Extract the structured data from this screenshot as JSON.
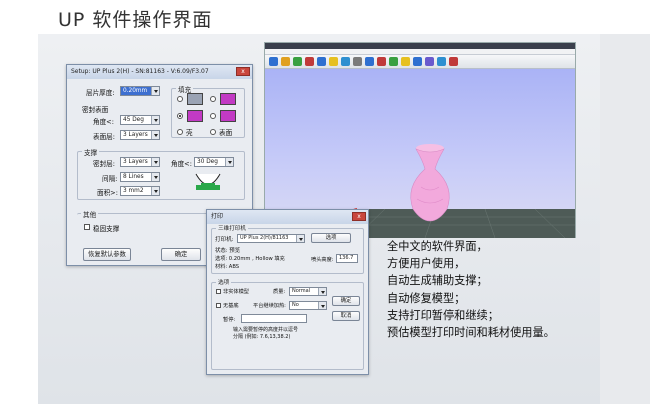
{
  "page": {
    "title": "UP 软件操作界面"
  },
  "setup_dialog": {
    "title": "Setup: UP Plus 2(H) - SN:81163 - V:6.09/F3.07",
    "close_label": "x",
    "layer_thickness_label": "层片厚度:",
    "layer_thickness_value": "0.20mm",
    "fill_label": "填充",
    "dense_surface_label": "密封表面",
    "angle_label": "角度<:",
    "angle_value": "45 Deg",
    "surface_layers_label": "表面层:",
    "surface_layers_value": "3 Layers",
    "shell_label": "壳",
    "surface_label": "表面",
    "support_label": "支撑",
    "support_dense_label": "密封层:",
    "support_dense_value": "3 Layers",
    "support_angle_label": "角度<:",
    "support_angle_value": "30 Deg",
    "spacing_label": "间隔:",
    "spacing_value": "8 Lines",
    "area_label": "面积>:",
    "area_value": "3 mm2",
    "other_label": "其他",
    "stable_support_label": "稳固支撑",
    "restore_defaults_button": "恢复默认参数",
    "ok_button": "确定"
  },
  "app_window": {
    "toolbar_icon_colors": [
      "#2e6fd0",
      "#e0a020",
      "#3aa040",
      "#c03a3a",
      "#2e6fd0",
      "#e6c020",
      "#2e8fd0",
      "#7a7a7a",
      "#2e6fd0",
      "#c03a3a",
      "#3aa040",
      "#e6c020",
      "#2e6fd0",
      "#6a5acd",
      "#2e8fd0",
      "#c03a3a"
    ],
    "accent_colors": {
      "platform": "#51605a",
      "model": "#f0a8d8",
      "sky_top": "#aab3f6"
    }
  },
  "print_dialog": {
    "title": "打印",
    "close_label": "x",
    "printer_group": "三维打印机",
    "printer_label": "打印机:",
    "printer_value": "UP Plus 2(H)/81163",
    "select_button": "选项",
    "status_label": "状态: 预览",
    "settings_label": "选项: 0.20mm , Hollow 填充",
    "material_label": "材料: ABS",
    "nozzle_height_label": "喷头高度:",
    "nozzle_height_value": "136.7",
    "options_group": "选项",
    "unsolid_label": "非实体模型",
    "quality_label": "质量:",
    "quality_value": "Normal",
    "no_raft_label": "无基底",
    "platform_heat_label": "平台继续加热:",
    "platform_heat_value": "No",
    "ok_button": "确定",
    "cancel_button": "取消",
    "pause_label": "暂停:",
    "pause_hint_1": "输入需要暂停的高度并以逗号",
    "pause_hint_2": "分隔 (例如: 7.6,13,38.2)"
  },
  "features": [
    "全中文的软件界面，",
    "方便用户使用，",
    "自动生成辅助支撑；",
    "自动修复模型；",
    "支持打印暂停和继续；",
    "预估模型打印时间和耗材使用量。"
  ]
}
